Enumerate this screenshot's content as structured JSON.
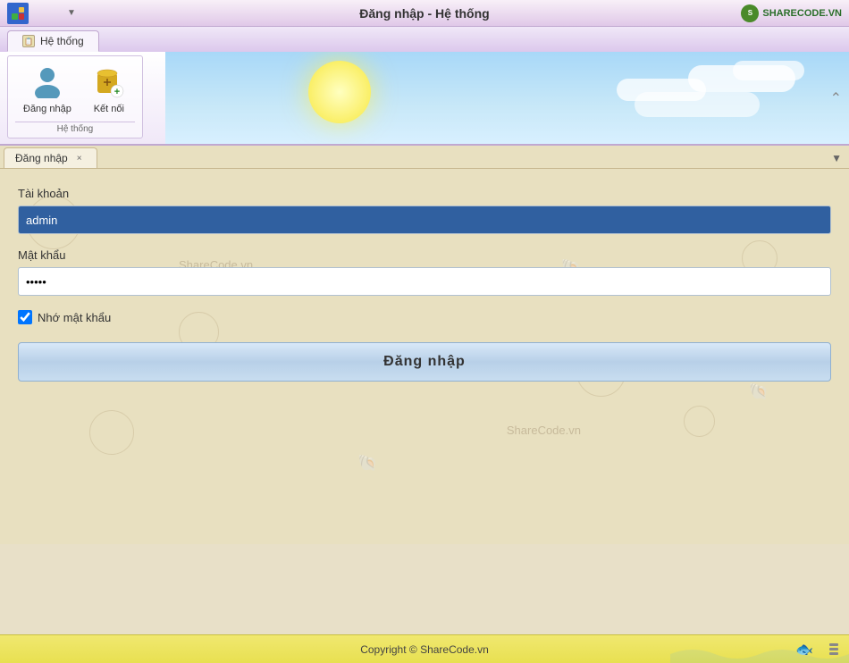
{
  "window": {
    "title": "Đăng nhập - Hệ thống",
    "sharecode_label": "SHARECODE.VN"
  },
  "ribbon": {
    "tab_label": "Hệ thống",
    "tab_icon": "📋",
    "group_label": "Hệ thống",
    "btn_login_label": "Đăng nhập",
    "btn_connect_label": "Kết nối"
  },
  "content_tab": {
    "label": "Đăng nhập",
    "close_label": "×"
  },
  "form": {
    "account_label": "Tài khoản",
    "account_value": "admin",
    "password_label": "Mật khẩu",
    "password_value": "*****",
    "remember_label": "Nhớ mật khẩu",
    "login_btn_label": "Đăng nhập"
  },
  "watermark1": "ShareCode.vn",
  "watermark2": "ShareCode.vn",
  "footer": {
    "copyright": "Copyright © ShareCode.vn"
  }
}
